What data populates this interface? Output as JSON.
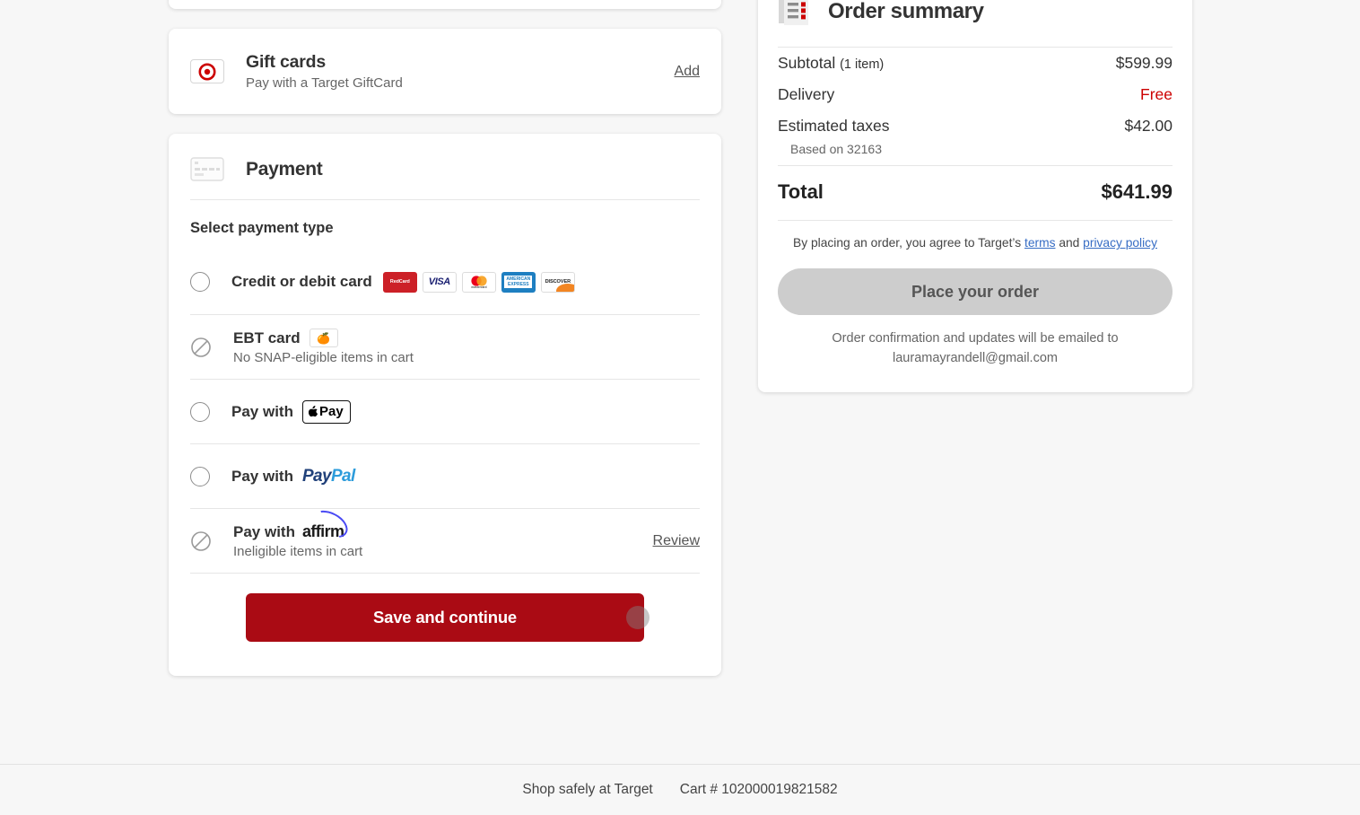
{
  "gift_cards": {
    "icon": "target-bullseye-icon",
    "title": "Gift cards",
    "subtitle": "Pay with a Target GiftCard",
    "action_label": "Add"
  },
  "payment": {
    "icon": "credit-card-icon",
    "title": "Payment",
    "select_label": "Select payment type",
    "options": [
      {
        "id": "credit-debit",
        "title": "Credit or debit card",
        "subtitle": "",
        "state": "enabled",
        "logos": [
          "RedCard",
          "VISA",
          "mastercard",
          "AMERICAN EXPRESS",
          "DISCOVER"
        ]
      },
      {
        "id": "ebt",
        "title": "EBT card",
        "subtitle": "No SNAP-eligible items in cart",
        "state": "disabled",
        "badge": "🍊"
      },
      {
        "id": "apple-pay",
        "title": "Pay with",
        "subtitle": "",
        "state": "enabled",
        "brand": "Pay"
      },
      {
        "id": "paypal",
        "title": "Pay with",
        "subtitle": "",
        "state": "enabled",
        "brand_a": "Pay",
        "brand_b": "Pal"
      },
      {
        "id": "affirm",
        "title": "Pay with",
        "subtitle": "Ineligible items in cart",
        "state": "disabled",
        "brand": "affirm",
        "action_label": "Review"
      }
    ],
    "save_label": "Save and continue"
  },
  "order_summary": {
    "icon": "receipt-icon",
    "title": "Order summary",
    "lines": [
      {
        "label": "Subtotal",
        "sub": "(1 item)",
        "value": "$599.99",
        "highlight": false
      },
      {
        "label": "Delivery",
        "sub": "",
        "value": "Free",
        "highlight": true
      },
      {
        "label": "Estimated taxes",
        "sub": "",
        "value": "$42.00",
        "highlight": false
      }
    ],
    "based_on": "Based on 32163",
    "total_label": "Total",
    "total_value": "$641.99",
    "terms_pre": "By placing an order, you agree to Target’s ",
    "terms_link": "terms",
    "terms_mid": " and ",
    "privacy_link": "privacy policy",
    "place_order_label": "Place your order",
    "confirm_text": "Order confirmation and updates will be emailed to",
    "confirm_email": "lauramayrandell@gmail.com"
  },
  "footer": {
    "shop_safely": "Shop safely at Target",
    "cart_number": "Cart # 102000019821582"
  },
  "colors": {
    "brand_red": "#cc0000",
    "button_red": "#aa0b14",
    "link_blue": "#366cc4",
    "page_bg": "#f7f7f7"
  }
}
